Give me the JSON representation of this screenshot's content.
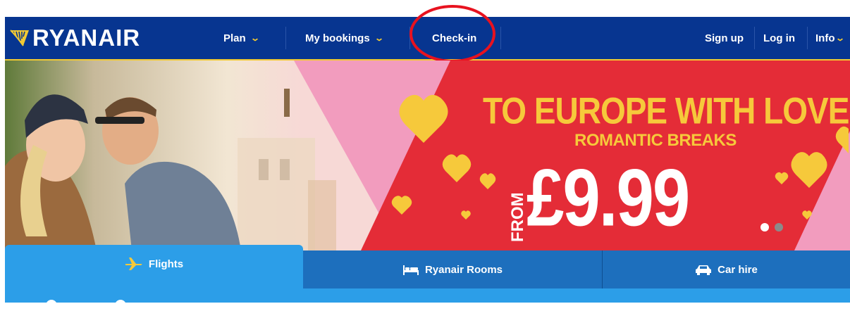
{
  "brand": {
    "name": "RYANAIR",
    "logo_icon": "harp-icon"
  },
  "nav": {
    "plan": "Plan",
    "my_bookings": "My bookings",
    "check_in": "Check-in",
    "sign_up": "Sign up",
    "log_in": "Log in",
    "info": "Info"
  },
  "hero": {
    "headline": "TO EUROPE WITH LOVE",
    "subheadline": "ROMANTIC BREAKS",
    "from_label": "FROM",
    "price": "£9.99",
    "carousel": {
      "slides": 2,
      "active_index": 0
    }
  },
  "tabs": [
    {
      "label": "Flights",
      "icon": "plane-icon",
      "active": true
    },
    {
      "label": "Ryanair Rooms",
      "icon": "bed-icon",
      "active": false
    },
    {
      "label": "Car hire",
      "icon": "car-icon",
      "active": false
    }
  ],
  "colors": {
    "nav_bg": "#073590",
    "accent_yellow": "#f1c933",
    "hero_red": "#e42c37",
    "hero_pink": "#f29cbe",
    "tab_active": "#2c9ee8",
    "tab_inactive": "#1d6fbd",
    "callout_red": "#e8121f"
  }
}
